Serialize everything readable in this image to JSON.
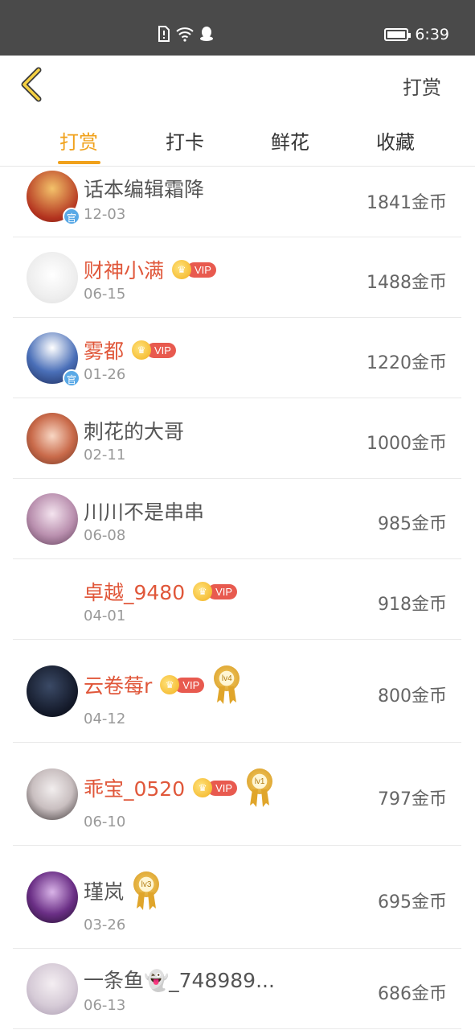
{
  "status_bar": {
    "time": "6:39"
  },
  "header": {
    "action_label": "打赏"
  },
  "tabs": [
    {
      "label": "打赏",
      "active": true
    },
    {
      "label": "打卡",
      "active": false
    },
    {
      "label": "鲜花",
      "active": false
    },
    {
      "label": "收藏",
      "active": false
    }
  ],
  "vip_label": "VIP",
  "list": [
    {
      "name": "话本编辑霜降",
      "date": "12-03",
      "amount": "1841金币",
      "vip": false,
      "medal": ""
    },
    {
      "name": "财神小满",
      "date": "06-15",
      "amount": "1488金币",
      "vip": true,
      "medal": ""
    },
    {
      "name": "雾都",
      "date": "01-26",
      "amount": "1220金币",
      "vip": true,
      "medal": ""
    },
    {
      "name": "刺花的大哥",
      "date": "02-11",
      "amount": "1000金币",
      "vip": false,
      "medal": ""
    },
    {
      "name": "川川不是串串",
      "date": "06-08",
      "amount": "985金币",
      "vip": false,
      "medal": ""
    },
    {
      "name": "卓越_9480",
      "date": "04-01",
      "amount": "918金币",
      "vip": true,
      "medal": ""
    },
    {
      "name": "云卷莓r",
      "date": "04-12",
      "amount": "800金币",
      "vip": true,
      "medal": "lv4"
    },
    {
      "name": "乖宝_0520",
      "date": "06-10",
      "amount": "797金币",
      "vip": true,
      "medal": "lv1"
    },
    {
      "name": "瑾岚",
      "date": "03-26",
      "amount": "695金币",
      "vip": false,
      "medal": "lv3"
    },
    {
      "name": "一条鱼👻_748989...",
      "date": "06-13",
      "amount": "686金币",
      "vip": false,
      "medal": ""
    }
  ],
  "colors": {
    "accent": "#f0a11b",
    "vip_name": "#e0573a",
    "status_bar": "#4a4a4a"
  }
}
